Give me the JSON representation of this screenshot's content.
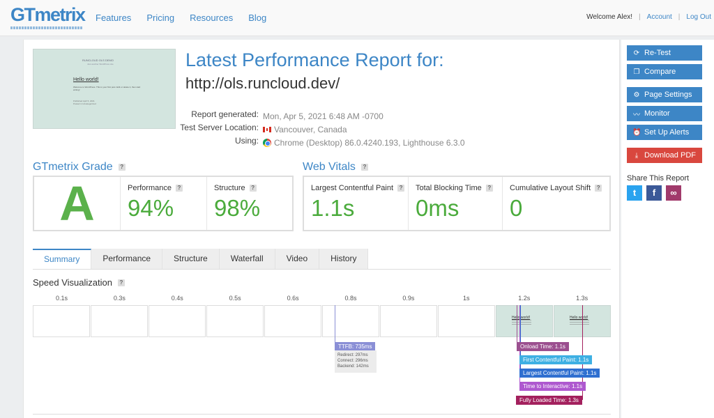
{
  "header": {
    "logo": "GTmetrix",
    "nav": [
      "Features",
      "Pricing",
      "Resources",
      "Blog"
    ],
    "welcome": "Welcome Alex!",
    "account": "Account",
    "logout": "Log Out"
  },
  "report": {
    "title": "Latest Performance Report for:",
    "url": "http://ols.runcloud.dev/",
    "thumb": {
      "site_title": "RUNCLOUD OLS DEMO",
      "tagline": "Just another WordPress site",
      "post_title": "Hello world!",
      "post_body": "Welcome to WordPress. This is your first post. Edit or delete it, then start writing!",
      "post_meta": "Published April 5, 2021",
      "post_author": "Posted in Uncategorized"
    },
    "meta": [
      {
        "key": "Report generated:",
        "value": "Mon, Apr 5, 2021 6:48 AM -0700",
        "icon": ""
      },
      {
        "key": "Test Server Location:",
        "value": "Vancouver, Canada",
        "icon": "canada-flag-icon"
      },
      {
        "key": "Using:",
        "value": "Chrome (Desktop) 86.0.4240.193, Lighthouse 6.3.0",
        "icon": "chrome-icon"
      }
    ]
  },
  "grade": {
    "title": "GTmetrix Grade",
    "letter": "A",
    "performance_label": "Performance",
    "performance_value": "94%",
    "structure_label": "Structure",
    "structure_value": "98%"
  },
  "vitals": {
    "title": "Web Vitals",
    "lcp_label": "Largest Contentful Paint",
    "lcp_value": "1.1s",
    "tbt_label": "Total Blocking Time",
    "tbt_value": "0ms",
    "cls_label": "Cumulative Layout Shift",
    "cls_value": "0"
  },
  "tabs": [
    "Summary",
    "Performance",
    "Structure",
    "Waterfall",
    "Video",
    "History"
  ],
  "speed": {
    "title": "Speed Visualization",
    "ticks": [
      "0.1s",
      "0.3s",
      "0.4s",
      "0.5s",
      "0.6s",
      "0.8s",
      "0.9s",
      "1s",
      "1.2s",
      "1.3s"
    ],
    "ttfb": "TTFB: 735ms",
    "ttfb_detail": [
      "Redirect: 297ms",
      "Connect: 296ms",
      "Backend: 142ms"
    ],
    "events": [
      {
        "label": "Onload Time: 1.1s",
        "color": "#9b4f8f"
      },
      {
        "label": "First Contentful Paint: 1.1s",
        "color": "#3eb0e3"
      },
      {
        "label": "Largest Contentful Paint: 1.1s",
        "color": "#2f6fd0"
      },
      {
        "label": "Time to Interactive: 1.1s",
        "color": "#ae58cf"
      },
      {
        "label": "Fully Loaded Time: 1.3s",
        "color": "#a3205d"
      }
    ],
    "ttfb_color": "#8a8fd6"
  },
  "sidebar": {
    "retest": "Re-Test",
    "compare": "Compare",
    "page_settings": "Page Settings",
    "monitor": "Monitor",
    "alerts": "Set Up Alerts",
    "pdf": "Download PDF",
    "share": "Share This Report"
  }
}
